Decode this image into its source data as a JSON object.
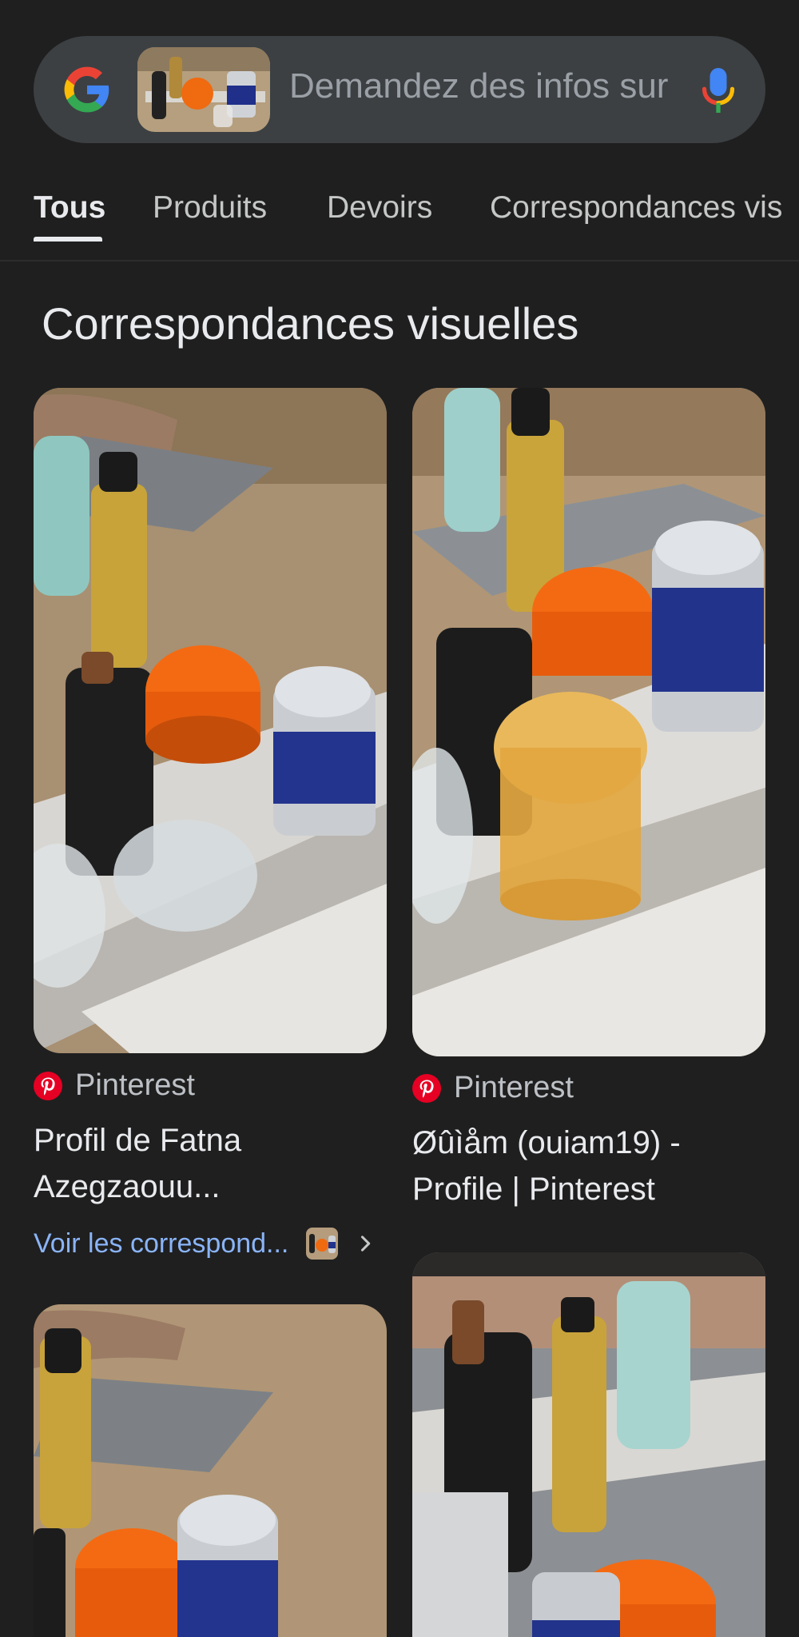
{
  "search": {
    "placeholder": "Demandez des infos sur"
  },
  "tabs": [
    {
      "label": "Tous",
      "active": true
    },
    {
      "label": "Produits",
      "active": false
    },
    {
      "label": "Devoirs",
      "active": false
    },
    {
      "label": "Correspondances vis",
      "active": false
    }
  ],
  "section": {
    "title": "Correspondances visuelles"
  },
  "results": [
    {
      "source": "Pinterest",
      "title_line1": "Profil de Fatna",
      "title_line2": "Azegzaouu...",
      "more_label": "Voir les correspond..."
    },
    {
      "source": "Pinterest",
      "title_line1": "Øûìåm (ouiam19) -",
      "title_line2": "Profile | Pinterest"
    }
  ],
  "icons": {
    "google": "google-g-icon",
    "mic": "microphone-icon",
    "pinterest": "pinterest-icon",
    "chevron": "chevron-right-icon"
  },
  "colors": {
    "background": "#1f1f1f",
    "searchbar": "#3c4043",
    "link": "#8ab4f8",
    "pinterest": "#e60023"
  }
}
